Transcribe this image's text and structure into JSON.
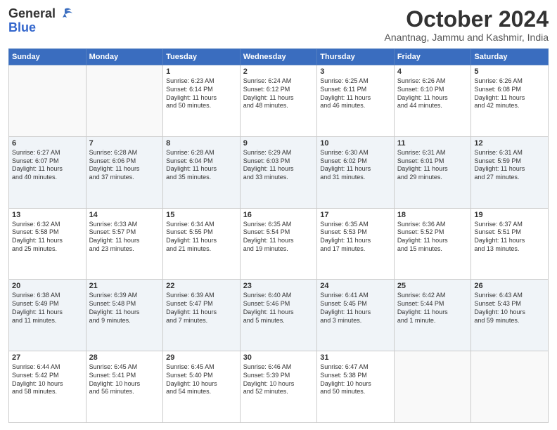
{
  "header": {
    "logo_general": "General",
    "logo_blue": "Blue",
    "month": "October 2024",
    "location": "Anantnag, Jammu and Kashmir, India"
  },
  "days_of_week": [
    "Sunday",
    "Monday",
    "Tuesday",
    "Wednesday",
    "Thursday",
    "Friday",
    "Saturday"
  ],
  "weeks": [
    [
      {
        "day": "",
        "lines": []
      },
      {
        "day": "",
        "lines": []
      },
      {
        "day": "1",
        "lines": [
          "Sunrise: 6:23 AM",
          "Sunset: 6:14 PM",
          "Daylight: 11 hours",
          "and 50 minutes."
        ]
      },
      {
        "day": "2",
        "lines": [
          "Sunrise: 6:24 AM",
          "Sunset: 6:12 PM",
          "Daylight: 11 hours",
          "and 48 minutes."
        ]
      },
      {
        "day": "3",
        "lines": [
          "Sunrise: 6:25 AM",
          "Sunset: 6:11 PM",
          "Daylight: 11 hours",
          "and 46 minutes."
        ]
      },
      {
        "day": "4",
        "lines": [
          "Sunrise: 6:26 AM",
          "Sunset: 6:10 PM",
          "Daylight: 11 hours",
          "and 44 minutes."
        ]
      },
      {
        "day": "5",
        "lines": [
          "Sunrise: 6:26 AM",
          "Sunset: 6:08 PM",
          "Daylight: 11 hours",
          "and 42 minutes."
        ]
      }
    ],
    [
      {
        "day": "6",
        "lines": [
          "Sunrise: 6:27 AM",
          "Sunset: 6:07 PM",
          "Daylight: 11 hours",
          "and 40 minutes."
        ]
      },
      {
        "day": "7",
        "lines": [
          "Sunrise: 6:28 AM",
          "Sunset: 6:06 PM",
          "Daylight: 11 hours",
          "and 37 minutes."
        ]
      },
      {
        "day": "8",
        "lines": [
          "Sunrise: 6:28 AM",
          "Sunset: 6:04 PM",
          "Daylight: 11 hours",
          "and 35 minutes."
        ]
      },
      {
        "day": "9",
        "lines": [
          "Sunrise: 6:29 AM",
          "Sunset: 6:03 PM",
          "Daylight: 11 hours",
          "and 33 minutes."
        ]
      },
      {
        "day": "10",
        "lines": [
          "Sunrise: 6:30 AM",
          "Sunset: 6:02 PM",
          "Daylight: 11 hours",
          "and 31 minutes."
        ]
      },
      {
        "day": "11",
        "lines": [
          "Sunrise: 6:31 AM",
          "Sunset: 6:01 PM",
          "Daylight: 11 hours",
          "and 29 minutes."
        ]
      },
      {
        "day": "12",
        "lines": [
          "Sunrise: 6:31 AM",
          "Sunset: 5:59 PM",
          "Daylight: 11 hours",
          "and 27 minutes."
        ]
      }
    ],
    [
      {
        "day": "13",
        "lines": [
          "Sunrise: 6:32 AM",
          "Sunset: 5:58 PM",
          "Daylight: 11 hours",
          "and 25 minutes."
        ]
      },
      {
        "day": "14",
        "lines": [
          "Sunrise: 6:33 AM",
          "Sunset: 5:57 PM",
          "Daylight: 11 hours",
          "and 23 minutes."
        ]
      },
      {
        "day": "15",
        "lines": [
          "Sunrise: 6:34 AM",
          "Sunset: 5:55 PM",
          "Daylight: 11 hours",
          "and 21 minutes."
        ]
      },
      {
        "day": "16",
        "lines": [
          "Sunrise: 6:35 AM",
          "Sunset: 5:54 PM",
          "Daylight: 11 hours",
          "and 19 minutes."
        ]
      },
      {
        "day": "17",
        "lines": [
          "Sunrise: 6:35 AM",
          "Sunset: 5:53 PM",
          "Daylight: 11 hours",
          "and 17 minutes."
        ]
      },
      {
        "day": "18",
        "lines": [
          "Sunrise: 6:36 AM",
          "Sunset: 5:52 PM",
          "Daylight: 11 hours",
          "and 15 minutes."
        ]
      },
      {
        "day": "19",
        "lines": [
          "Sunrise: 6:37 AM",
          "Sunset: 5:51 PM",
          "Daylight: 11 hours",
          "and 13 minutes."
        ]
      }
    ],
    [
      {
        "day": "20",
        "lines": [
          "Sunrise: 6:38 AM",
          "Sunset: 5:49 PM",
          "Daylight: 11 hours",
          "and 11 minutes."
        ]
      },
      {
        "day": "21",
        "lines": [
          "Sunrise: 6:39 AM",
          "Sunset: 5:48 PM",
          "Daylight: 11 hours",
          "and 9 minutes."
        ]
      },
      {
        "day": "22",
        "lines": [
          "Sunrise: 6:39 AM",
          "Sunset: 5:47 PM",
          "Daylight: 11 hours",
          "and 7 minutes."
        ]
      },
      {
        "day": "23",
        "lines": [
          "Sunrise: 6:40 AM",
          "Sunset: 5:46 PM",
          "Daylight: 11 hours",
          "and 5 minutes."
        ]
      },
      {
        "day": "24",
        "lines": [
          "Sunrise: 6:41 AM",
          "Sunset: 5:45 PM",
          "Daylight: 11 hours",
          "and 3 minutes."
        ]
      },
      {
        "day": "25",
        "lines": [
          "Sunrise: 6:42 AM",
          "Sunset: 5:44 PM",
          "Daylight: 11 hours",
          "and 1 minute."
        ]
      },
      {
        "day": "26",
        "lines": [
          "Sunrise: 6:43 AM",
          "Sunset: 5:43 PM",
          "Daylight: 10 hours",
          "and 59 minutes."
        ]
      }
    ],
    [
      {
        "day": "27",
        "lines": [
          "Sunrise: 6:44 AM",
          "Sunset: 5:42 PM",
          "Daylight: 10 hours",
          "and 58 minutes."
        ]
      },
      {
        "day": "28",
        "lines": [
          "Sunrise: 6:45 AM",
          "Sunset: 5:41 PM",
          "Daylight: 10 hours",
          "and 56 minutes."
        ]
      },
      {
        "day": "29",
        "lines": [
          "Sunrise: 6:45 AM",
          "Sunset: 5:40 PM",
          "Daylight: 10 hours",
          "and 54 minutes."
        ]
      },
      {
        "day": "30",
        "lines": [
          "Sunrise: 6:46 AM",
          "Sunset: 5:39 PM",
          "Daylight: 10 hours",
          "and 52 minutes."
        ]
      },
      {
        "day": "31",
        "lines": [
          "Sunrise: 6:47 AM",
          "Sunset: 5:38 PM",
          "Daylight: 10 hours",
          "and 50 minutes."
        ]
      },
      {
        "day": "",
        "lines": []
      },
      {
        "day": "",
        "lines": []
      }
    ]
  ]
}
